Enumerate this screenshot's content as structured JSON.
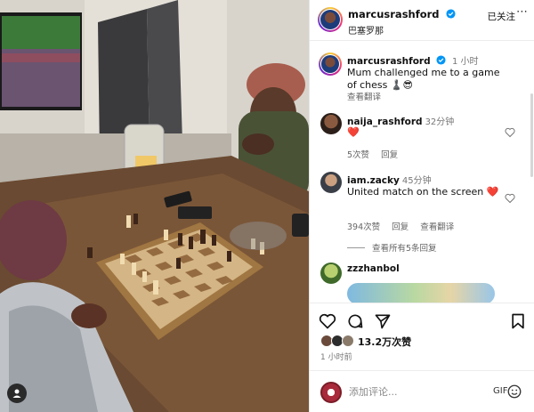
{
  "post": {
    "photo": {
      "description_icon": "user-tag-icon"
    },
    "header": {
      "username": "marcusrashford",
      "location": "巴塞罗那",
      "follow_label": "已关注",
      "more_icon": "more-options-icon"
    },
    "caption": {
      "username": "marcusrashford",
      "time": "1 小时",
      "text": "Mum challenged me to a game of chess ♟️😎",
      "translate_label": "查看翻译"
    },
    "comments": [
      {
        "username": "naija_rashford",
        "time": "32分钟",
        "text": "❤️",
        "likes": "5次赞",
        "reply_label": "回复"
      },
      {
        "username": "iam.zacky",
        "time": "45分钟",
        "text": "United match on the screen ❤️",
        "likes": "394次赞",
        "reply_label": "回复",
        "translate_label": "查看翻译",
        "view_replies": "查看所有5条回复"
      },
      {
        "username": "zzzhanbol"
      }
    ],
    "actions": {
      "likes_count": "13.2万次赞",
      "time_ago": "1 小时前"
    },
    "add_comment": {
      "placeholder": "添加评论...",
      "gif_label": "GIF"
    },
    "colors": {
      "verified": "#0095f6",
      "heart_red": "#ed4956",
      "text": "#111111",
      "secondary": "#737373"
    }
  }
}
